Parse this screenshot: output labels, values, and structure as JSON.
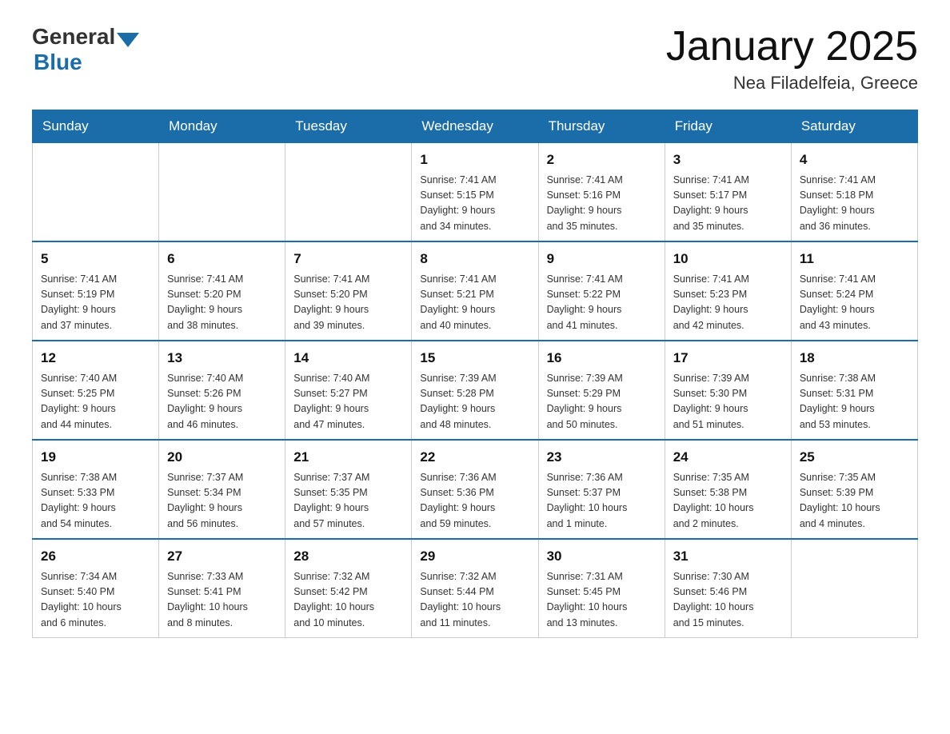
{
  "header": {
    "logo": {
      "general": "General",
      "blue": "Blue"
    },
    "title": "January 2025",
    "location": "Nea Filadelfeia, Greece"
  },
  "calendar": {
    "days": [
      "Sunday",
      "Monday",
      "Tuesday",
      "Wednesday",
      "Thursday",
      "Friday",
      "Saturday"
    ],
    "weeks": [
      [
        {
          "day": "",
          "info": ""
        },
        {
          "day": "",
          "info": ""
        },
        {
          "day": "",
          "info": ""
        },
        {
          "day": "1",
          "info": "Sunrise: 7:41 AM\nSunset: 5:15 PM\nDaylight: 9 hours\nand 34 minutes."
        },
        {
          "day": "2",
          "info": "Sunrise: 7:41 AM\nSunset: 5:16 PM\nDaylight: 9 hours\nand 35 minutes."
        },
        {
          "day": "3",
          "info": "Sunrise: 7:41 AM\nSunset: 5:17 PM\nDaylight: 9 hours\nand 35 minutes."
        },
        {
          "day": "4",
          "info": "Sunrise: 7:41 AM\nSunset: 5:18 PM\nDaylight: 9 hours\nand 36 minutes."
        }
      ],
      [
        {
          "day": "5",
          "info": "Sunrise: 7:41 AM\nSunset: 5:19 PM\nDaylight: 9 hours\nand 37 minutes."
        },
        {
          "day": "6",
          "info": "Sunrise: 7:41 AM\nSunset: 5:20 PM\nDaylight: 9 hours\nand 38 minutes."
        },
        {
          "day": "7",
          "info": "Sunrise: 7:41 AM\nSunset: 5:20 PM\nDaylight: 9 hours\nand 39 minutes."
        },
        {
          "day": "8",
          "info": "Sunrise: 7:41 AM\nSunset: 5:21 PM\nDaylight: 9 hours\nand 40 minutes."
        },
        {
          "day": "9",
          "info": "Sunrise: 7:41 AM\nSunset: 5:22 PM\nDaylight: 9 hours\nand 41 minutes."
        },
        {
          "day": "10",
          "info": "Sunrise: 7:41 AM\nSunset: 5:23 PM\nDaylight: 9 hours\nand 42 minutes."
        },
        {
          "day": "11",
          "info": "Sunrise: 7:41 AM\nSunset: 5:24 PM\nDaylight: 9 hours\nand 43 minutes."
        }
      ],
      [
        {
          "day": "12",
          "info": "Sunrise: 7:40 AM\nSunset: 5:25 PM\nDaylight: 9 hours\nand 44 minutes."
        },
        {
          "day": "13",
          "info": "Sunrise: 7:40 AM\nSunset: 5:26 PM\nDaylight: 9 hours\nand 46 minutes."
        },
        {
          "day": "14",
          "info": "Sunrise: 7:40 AM\nSunset: 5:27 PM\nDaylight: 9 hours\nand 47 minutes."
        },
        {
          "day": "15",
          "info": "Sunrise: 7:39 AM\nSunset: 5:28 PM\nDaylight: 9 hours\nand 48 minutes."
        },
        {
          "day": "16",
          "info": "Sunrise: 7:39 AM\nSunset: 5:29 PM\nDaylight: 9 hours\nand 50 minutes."
        },
        {
          "day": "17",
          "info": "Sunrise: 7:39 AM\nSunset: 5:30 PM\nDaylight: 9 hours\nand 51 minutes."
        },
        {
          "day": "18",
          "info": "Sunrise: 7:38 AM\nSunset: 5:31 PM\nDaylight: 9 hours\nand 53 minutes."
        }
      ],
      [
        {
          "day": "19",
          "info": "Sunrise: 7:38 AM\nSunset: 5:33 PM\nDaylight: 9 hours\nand 54 minutes."
        },
        {
          "day": "20",
          "info": "Sunrise: 7:37 AM\nSunset: 5:34 PM\nDaylight: 9 hours\nand 56 minutes."
        },
        {
          "day": "21",
          "info": "Sunrise: 7:37 AM\nSunset: 5:35 PM\nDaylight: 9 hours\nand 57 minutes."
        },
        {
          "day": "22",
          "info": "Sunrise: 7:36 AM\nSunset: 5:36 PM\nDaylight: 9 hours\nand 59 minutes."
        },
        {
          "day": "23",
          "info": "Sunrise: 7:36 AM\nSunset: 5:37 PM\nDaylight: 10 hours\nand 1 minute."
        },
        {
          "day": "24",
          "info": "Sunrise: 7:35 AM\nSunset: 5:38 PM\nDaylight: 10 hours\nand 2 minutes."
        },
        {
          "day": "25",
          "info": "Sunrise: 7:35 AM\nSunset: 5:39 PM\nDaylight: 10 hours\nand 4 minutes."
        }
      ],
      [
        {
          "day": "26",
          "info": "Sunrise: 7:34 AM\nSunset: 5:40 PM\nDaylight: 10 hours\nand 6 minutes."
        },
        {
          "day": "27",
          "info": "Sunrise: 7:33 AM\nSunset: 5:41 PM\nDaylight: 10 hours\nand 8 minutes."
        },
        {
          "day": "28",
          "info": "Sunrise: 7:32 AM\nSunset: 5:42 PM\nDaylight: 10 hours\nand 10 minutes."
        },
        {
          "day": "29",
          "info": "Sunrise: 7:32 AM\nSunset: 5:44 PM\nDaylight: 10 hours\nand 11 minutes."
        },
        {
          "day": "30",
          "info": "Sunrise: 7:31 AM\nSunset: 5:45 PM\nDaylight: 10 hours\nand 13 minutes."
        },
        {
          "day": "31",
          "info": "Sunrise: 7:30 AM\nSunset: 5:46 PM\nDaylight: 10 hours\nand 15 minutes."
        },
        {
          "day": "",
          "info": ""
        }
      ]
    ]
  }
}
